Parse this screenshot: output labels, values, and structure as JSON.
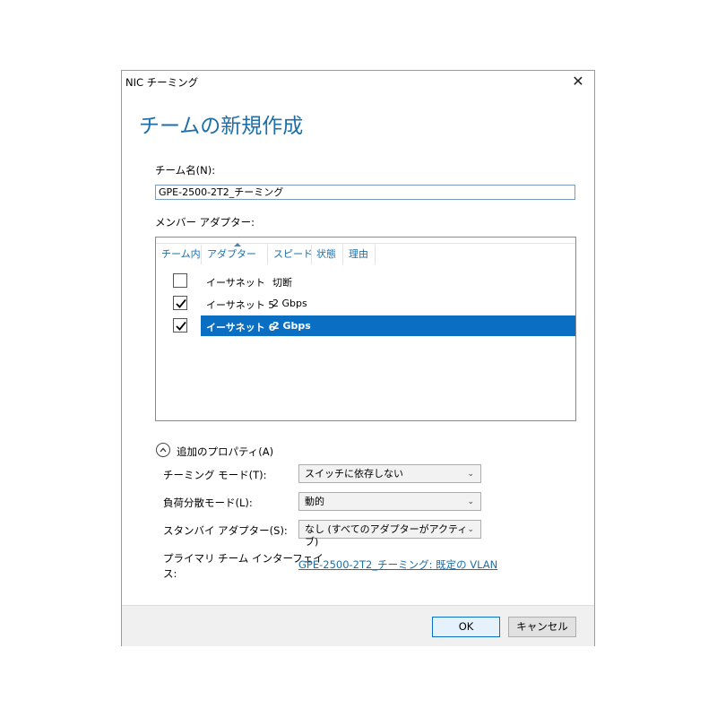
{
  "window": {
    "title": "NIC チーミング",
    "close_glyph": "✕"
  },
  "heading": "チームの新規作成",
  "team_name": {
    "label": "チーム名(N):",
    "value": "GPE-2500-2T2_チーミング"
  },
  "member_adapters": {
    "label": "メンバー アダプター:",
    "columns": [
      "チーム内",
      "アダプター",
      "スピード",
      "状態",
      "理由"
    ],
    "rows": [
      {
        "checked": false,
        "adapter": "イーサネット",
        "speed": "切断",
        "selected": false
      },
      {
        "checked": true,
        "adapter": "イーサネット 5",
        "speed": "2 Gbps",
        "selected": false
      },
      {
        "checked": true,
        "adapter": "イーサネット 6",
        "speed": "2 Gbps",
        "selected": true
      }
    ]
  },
  "additional_properties": {
    "label": "追加のプロパティ(A)",
    "teaming_mode": {
      "label": "チーミング モード(T):",
      "value": "スイッチに依存しない"
    },
    "load_balancing": {
      "label": "負荷分散モード(L):",
      "value": "動的"
    },
    "standby_adapter": {
      "label": "スタンバイ アダプター(S):",
      "value": "なし (すべてのアダプターがアクティブ)"
    },
    "primary_interface": {
      "label_line1": "プライマリ チーム インターフェイ",
      "label_line2": "ス:",
      "link": "GPE-2500-2T2_チーミング: 既定の VLAN"
    }
  },
  "buttons": {
    "ok": "OK",
    "cancel": "キャンセル"
  },
  "colors": {
    "accent": "#1e6fa8",
    "selection": "#0a6fc2"
  }
}
